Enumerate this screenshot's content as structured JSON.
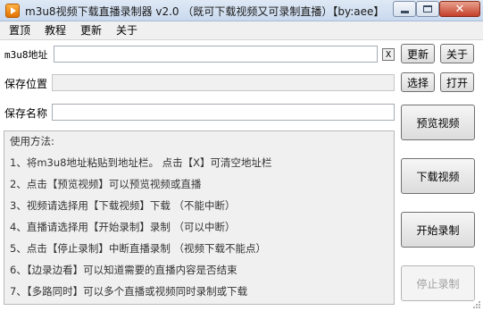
{
  "window": {
    "title": "m3u8视频下载直播录制器 v2.0 （既可下载视频又可录制直播）【by:aee】",
    "close_glyph": "✕"
  },
  "menu": {
    "items": [
      "置顶",
      "教程",
      "更新",
      "关于"
    ]
  },
  "form": {
    "url_label": "m3u8地址",
    "url_value": "",
    "clear_label": "X",
    "update_label": "更新",
    "about_label": "关于",
    "save_path_label": "保存位置",
    "save_path_value": "",
    "choose_label": "选择",
    "open_label": "打开",
    "save_name_label": "保存名称",
    "save_name_value": ""
  },
  "actions": {
    "preview_label": "预览视频",
    "download_label": "下载视频",
    "record_label": "开始录制",
    "stop_label": "停止录制"
  },
  "help": {
    "title": "使用方法:",
    "lines": [
      "1、将m3u8地址粘贴到地址栏。  点击【X】可清空地址栏",
      "2、点击【预览视频】可以预览视频或直播",
      "3、视频请选择用【下载视频】下载  （不能中断）",
      "4、直播请选择用【开始录制】录制  （可以中断）",
      "5、点击【停止录制】中断直播录制  （视频下载不能点）",
      "6、【边录边看】可以知道需要的直播内容是否结束",
      "7、【多路同时】可以多个直播或视频同时录制或下载"
    ]
  }
}
